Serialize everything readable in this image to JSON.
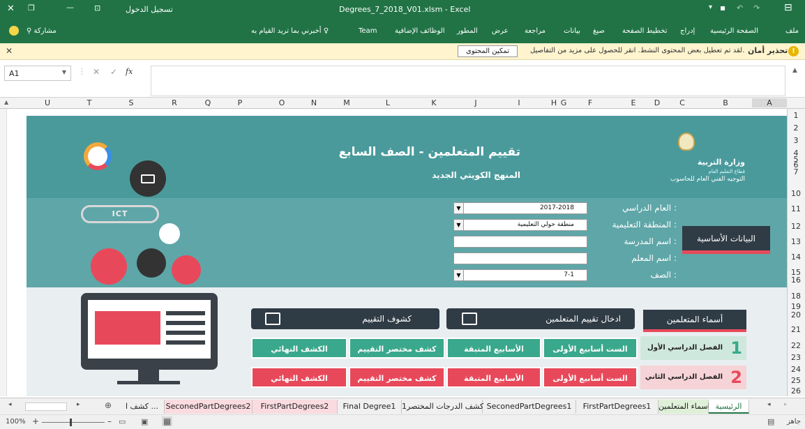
{
  "window": {
    "title": "Degrees_7_2018_V01.xlsm - Excel",
    "signin": "تسجيل الدخول"
  },
  "ribbon": {
    "tabs": [
      "ملف",
      "الصفحة الرئيسية",
      "إدراج",
      "تخطيط الصفحة",
      "صيغ",
      "بيانات",
      "مراجعة",
      "عرض",
      "المطور",
      "الوظائف الإضافية",
      "Team"
    ],
    "tell_me": "أخبرني بما تريد القيام به",
    "share": "مشاركة"
  },
  "message_bar": {
    "title": "تحذير أمان",
    "text": "لقد تم تعطيل بعض المحتوى النشط. انقر للحصول على مزيد من التفاصيل.",
    "button": "تمكين المحتوى"
  },
  "formula_bar": {
    "name_box": "A1",
    "fx": "fx",
    "value": ""
  },
  "columns": [
    "U",
    "T",
    "S",
    "R",
    "Q",
    "P",
    "O",
    "N",
    "M",
    "L",
    "K",
    "J",
    "I",
    "H",
    "G",
    "F",
    "E",
    "D",
    "C",
    "B",
    "A"
  ],
  "rows": [
    "1",
    "2",
    "3",
    "4",
    "5",
    "6",
    "7",
    "10",
    "11",
    "12",
    "13",
    "14",
    "15",
    "16",
    "18",
    "19",
    "20",
    "21",
    "22",
    "23",
    "24",
    "25",
    "26"
  ],
  "banner": {
    "title": "تقييم المتعلمين - الصف السابع",
    "subtitle": "المنهج الكويتي الجديد",
    "ministry": "وزارة التربية",
    "sector": "قطاع التعليم العام",
    "dept": "التوجيه الفني العام للحاسوب",
    "ict_logo": "ICT"
  },
  "form": {
    "section": "البيانات الأساسية",
    "year_label": "العام الدراسي :",
    "year_value": "2017-2018",
    "zone_label": "المنطقة التعليمية :",
    "zone_value": "منطقة حولي التعليمية",
    "school_label": "اسم المدرسة :",
    "school_value": "",
    "teacher_label": "اسم المعلم :",
    "teacher_value": "",
    "class_label": "الصف :",
    "class_value": "7-1"
  },
  "actions": {
    "names": "أسماء المتعلمين",
    "entry": "ادخال تقييم المتعلمين",
    "reports": "كشوف التقييم"
  },
  "term1": {
    "label": "الفصل الدراسي الأول",
    "num": "1",
    "b1": "الست أسابيع الأولى",
    "b2": "الأسابيع المتبقة",
    "b3": "كشف مختصر التقييم",
    "b4": "الكشف النهائي"
  },
  "term2": {
    "label": "الفصل الدراسي الثاني",
    "num": "2",
    "b1": "الست أسابيع الأولى",
    "b2": "الأسابيع المتبقة",
    "b3": "كشف مختصر التقييم",
    "b4": "الكشف النهائي"
  },
  "sheet_tabs": [
    "الرئيسية",
    "اسماء المتعلمين",
    "FirstPartDegrees1",
    "SeconedPartDegrees1",
    "كشف الدرجات المختصر1",
    "Final Degree1",
    "FirstPartDegrees2",
    "SeconedPartDegrees2",
    "كشف ا ..."
  ],
  "status": {
    "zoom": "100%",
    "ready": "جاهز"
  },
  "colors": {
    "excel_green": "#217346",
    "teal": "#4a9a9c",
    "pink": "#e8495a",
    "green_btn": "#3aa88c"
  }
}
